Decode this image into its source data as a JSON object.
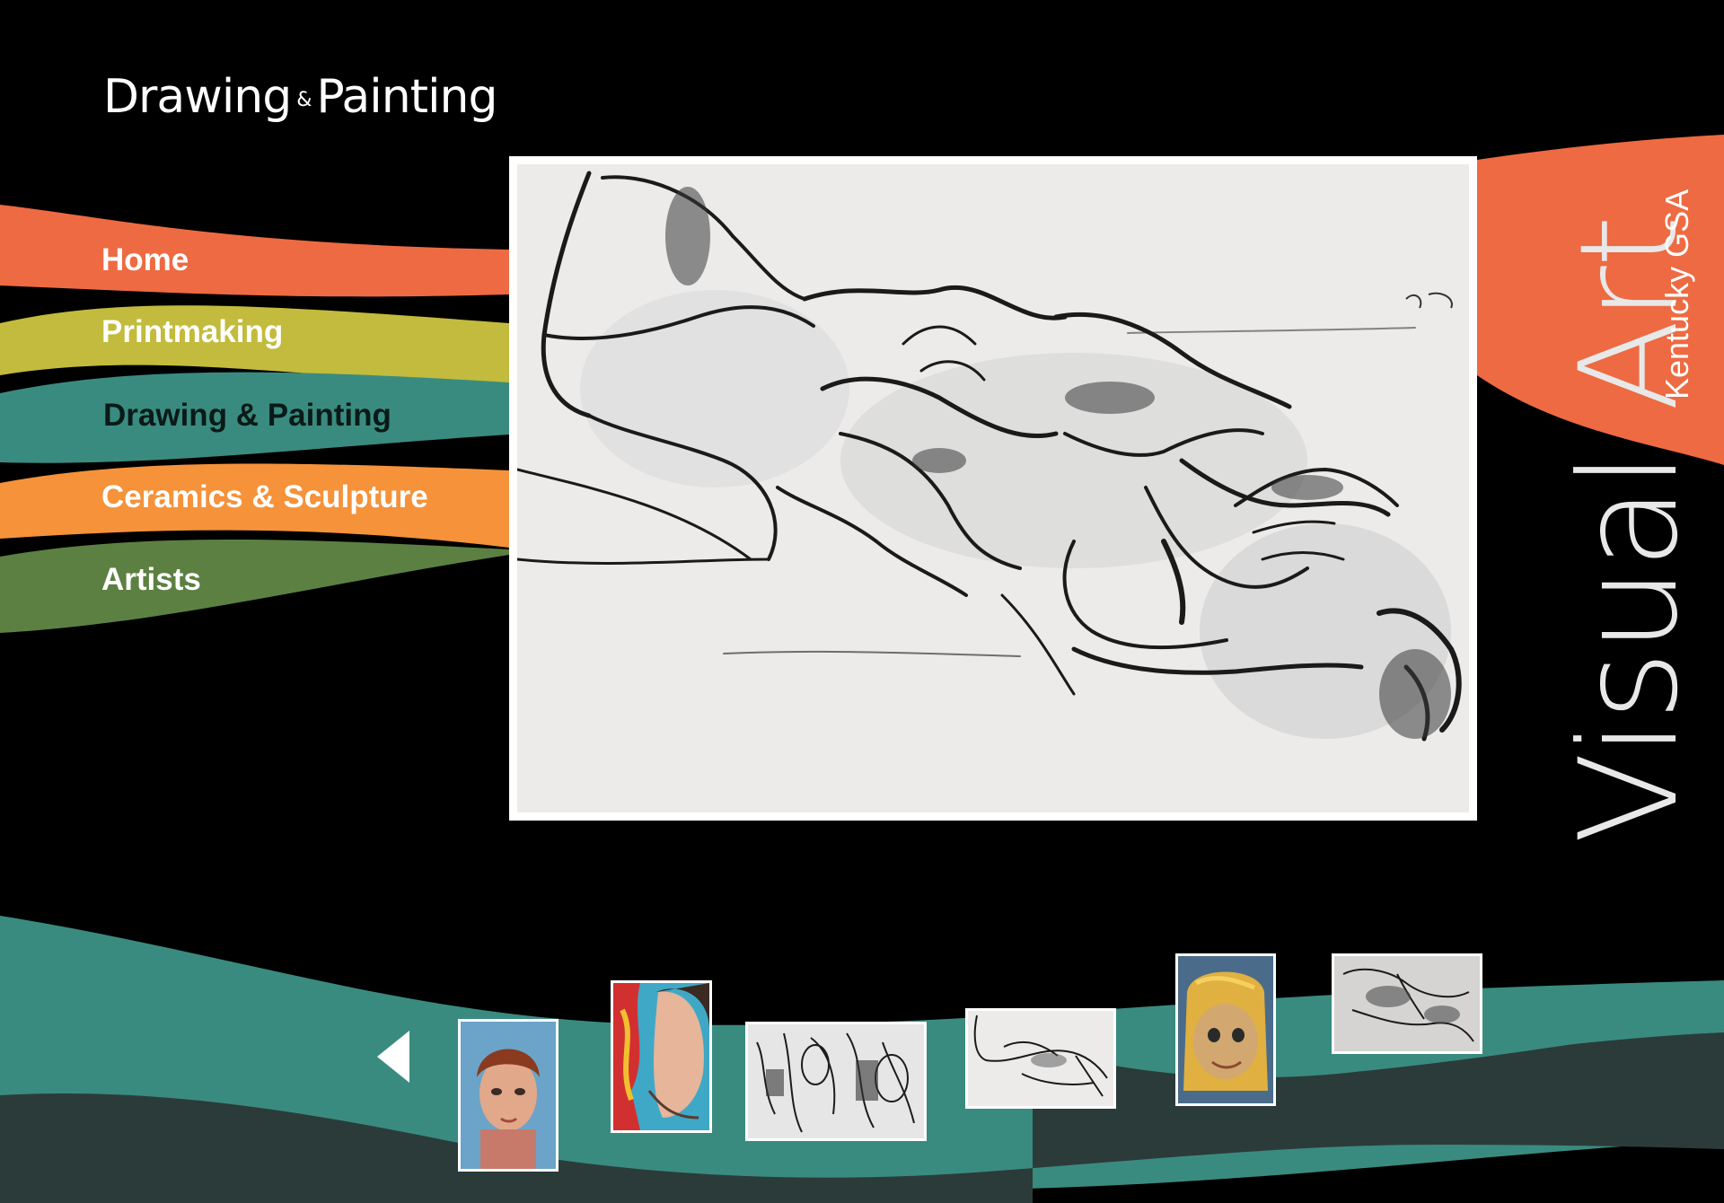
{
  "header": {
    "title_part1": "Drawing",
    "title_amp": "&",
    "title_part2": "Painting"
  },
  "nav": {
    "items": [
      {
        "label": "Home",
        "color": "#ee6a42",
        "text_color": "#ffffff"
      },
      {
        "label": "Printmaking",
        "color": "#c2bb3d",
        "text_color": "#ffffff"
      },
      {
        "label": "Drawing & Painting",
        "color": "#3a8b7f",
        "text_color": "#0a1a18"
      },
      {
        "label": "Ceramics & Sculpture",
        "color": "#f5923a",
        "text_color": "#ffffff"
      },
      {
        "label": "Artists",
        "color": "#5c8042",
        "text_color": "#ffffff"
      }
    ]
  },
  "banner": {
    "main_text": "Visual Art",
    "sub_text": "Kentucky GSA",
    "color": "#ee6a42"
  },
  "gallery": {
    "prev_icon": "left-triangle-arrow-icon",
    "thumbnails": [
      {
        "name": "portrait-watercolor"
      },
      {
        "name": "profile-colorful"
      },
      {
        "name": "charcoal-study-sheet"
      },
      {
        "name": "reclining-figure-charcoal"
      },
      {
        "name": "blonde-face-painting"
      },
      {
        "name": "figure-charcoal-small"
      }
    ]
  },
  "colors": {
    "background": "#000000",
    "teal": "#3a8b7f",
    "dark_slate": "#2b3b3a"
  }
}
